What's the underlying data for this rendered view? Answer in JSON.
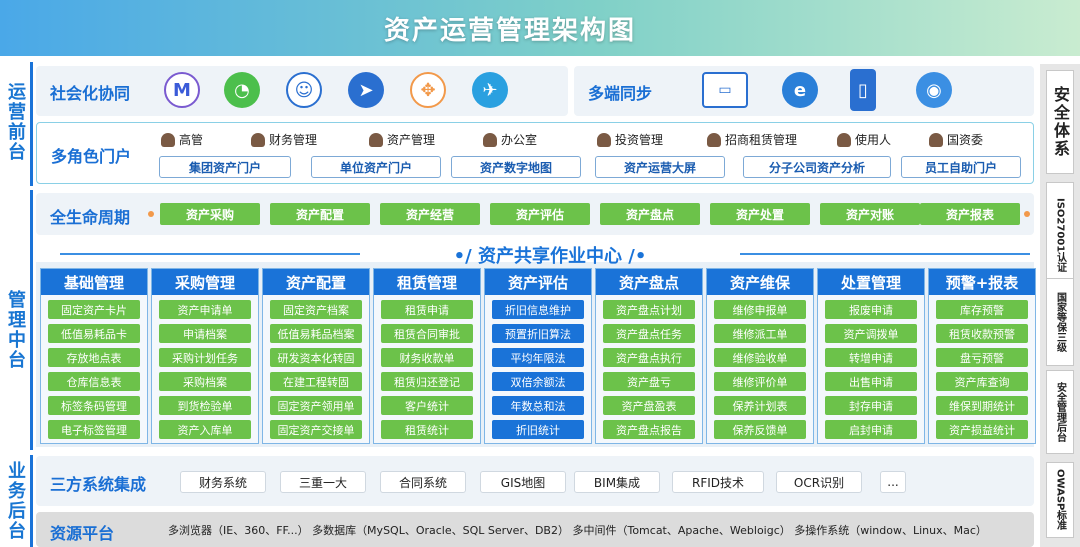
{
  "title": "资产运营管理架构图",
  "left_rail": {
    "front": "运营前台",
    "middle": "管理中台",
    "back": "业务后台"
  },
  "right_col": [
    "安全体系",
    "ISO27001认证",
    "国家等保三级",
    "安全管理后台",
    "OWASP标准"
  ],
  "social": {
    "title": "社会化协同",
    "icons": [
      "m-app-icon",
      "wechat-icon",
      "chat-bubble-icon",
      "dingtalk-icon",
      "puzzle-icon",
      "paper-plane-icon"
    ]
  },
  "multi": {
    "title": "多端同步",
    "icons": [
      "pc-icon",
      "ie-icon",
      "phone-icon",
      "browser-icon"
    ]
  },
  "roles": {
    "title": "多角色门户",
    "items": [
      "高管",
      "财务管理",
      "资产管理",
      "办公室",
      "投资管理",
      "招商租赁管理",
      "使用人",
      "国资委"
    ],
    "portals": [
      "集团资产门户",
      "单位资产门户",
      "资产数字地图",
      "资产运营大屏",
      "分子公司资产分析",
      "员工自助门户"
    ]
  },
  "lifecycle": {
    "title": "全生命周期",
    "steps": [
      "资产采购",
      "资产配置",
      "资产经营",
      "资产评估",
      "资产盘点",
      "资产处置",
      "资产对账",
      "资产报表"
    ]
  },
  "center": {
    "title": "•/ 资产共享作业中心 /•",
    "columns": [
      {
        "head": "基础管理",
        "items": [
          "固定资产卡片",
          "低值易耗品卡",
          "存放地点表",
          "仓库信息表",
          "标签条码管理",
          "电子标签管理"
        ]
      },
      {
        "head": "采购管理",
        "items": [
          "资产申请单",
          "申请档案",
          "采购计划任务",
          "采购档案",
          "到货检验单",
          "资产入库单"
        ]
      },
      {
        "head": "资产配置",
        "items": [
          "固定资产档案",
          "低值易耗品档案",
          "研发资本化转固",
          "在建工程转固",
          "固定资产领用单",
          "固定资产交接单"
        ]
      },
      {
        "head": "租赁管理",
        "items": [
          "租赁申请",
          "租赁合同审批",
          "财务收款单",
          "租赁归还登记",
          "客户统计",
          "租赁统计"
        ]
      },
      {
        "head": "资产评估",
        "items": [
          "折旧信息维护",
          "预置折旧算法",
          "平均年限法",
          "双倍余额法",
          "年数总和法",
          "折旧统计"
        ]
      },
      {
        "head": "资产盘点",
        "items": [
          "资产盘点计划",
          "资产盘点任务",
          "资产盘点执行",
          "资产盘亏",
          "资产盘盈表",
          "资产盘点报告"
        ]
      },
      {
        "head": "资产维保",
        "items": [
          "维修申报单",
          "维修派工单",
          "维修验收单",
          "维修评价单",
          "保养计划表",
          "保养反馈单"
        ]
      },
      {
        "head": "处置管理",
        "items": [
          "报废申请",
          "资产调拨单",
          "转增申请",
          "出售申请",
          "封存申请",
          "启封申请"
        ]
      },
      {
        "head": "预警+报表",
        "items": [
          "库存预警",
          "租赁收款预警",
          "盘亏预警",
          "资产库查询",
          "维保到期统计",
          "资产损益统计"
        ]
      }
    ]
  },
  "third": {
    "title": "三方系统集成",
    "items": [
      "财务系统",
      "三重一大",
      "合同系统",
      "GIS地图",
      "BIM集成",
      "RFID技术",
      "OCR识别",
      "..."
    ]
  },
  "resource": {
    "title": "资源平台",
    "text": "多浏览器（IE、360、FF...） 多数据库（MySQL、Oracle、SQL Server、DB2） 多中间件（Tomcat、Apache、Webloigc） 多操作系统（window、Linux、Mac）"
  },
  "colors": {
    "blue": "#1a73d8",
    "green": "#6cc24a",
    "orange": "#f2994a"
  }
}
